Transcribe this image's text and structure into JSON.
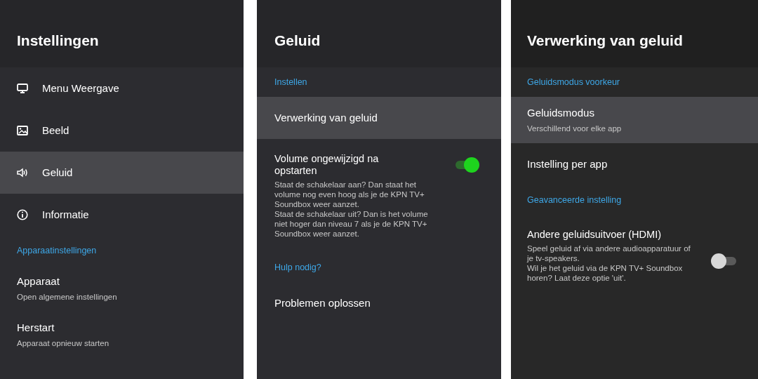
{
  "panels": [
    {
      "title": "Instellingen",
      "items": [
        {
          "kind": "icon_item",
          "label": "Menu Weergave",
          "selected": false
        },
        {
          "kind": "icon_item",
          "label": "Beeld",
          "selected": false
        },
        {
          "kind": "icon_item",
          "label": "Geluid",
          "selected": true
        },
        {
          "kind": "icon_item",
          "label": "Informatie",
          "selected": false
        },
        {
          "kind": "header",
          "label": "Apparaatinstellingen"
        },
        {
          "kind": "item",
          "label": "Apparaat",
          "sub": "Open algemene instellingen",
          "selected": false
        },
        {
          "kind": "item",
          "label": "Herstart",
          "sub": "Apparaat opnieuw starten",
          "selected": false
        }
      ]
    },
    {
      "title": "Geluid",
      "items": [
        {
          "kind": "header",
          "label": "Instellen"
        },
        {
          "kind": "item",
          "label": "Verwerking van geluid",
          "selected": true
        },
        {
          "kind": "toggle",
          "label": "Volume ongewijzigd na opstarten",
          "description": [
            "Staat de schakelaar aan? Dan staat het volume nog even hoog als je de KPN TV+ Soundbox weer aanzet.",
            "Staat de schakelaar uit? Dan is het volume niet hoger dan niveau 7 als je de KPN TV+ Soundbox weer aanzet."
          ],
          "on": true
        },
        {
          "kind": "header",
          "label": "Hulp nodig?"
        },
        {
          "kind": "item",
          "label": "Problemen oplossen",
          "selected": false
        }
      ]
    },
    {
      "title": "Verwerking van geluid",
      "items": [
        {
          "kind": "header",
          "label": "Geluidsmodus voorkeur"
        },
        {
          "kind": "item",
          "label": "Geluidsmodus",
          "sub": "Verschillend voor elke app",
          "selected": true
        },
        {
          "kind": "item",
          "label": "Instelling per app",
          "selected": false
        },
        {
          "kind": "header",
          "label": "Geavanceerde instelling"
        },
        {
          "kind": "toggle",
          "label": "Andere geluidsuitvoer (HDMI)",
          "description": [
            "Speel geluid af via andere audioapparatuur of je tv-speakers.",
            "Wil je het geluid via de KPN TV+ Soundbox horen? Laat deze optie 'uit'."
          ],
          "on": false
        }
      ]
    }
  ]
}
